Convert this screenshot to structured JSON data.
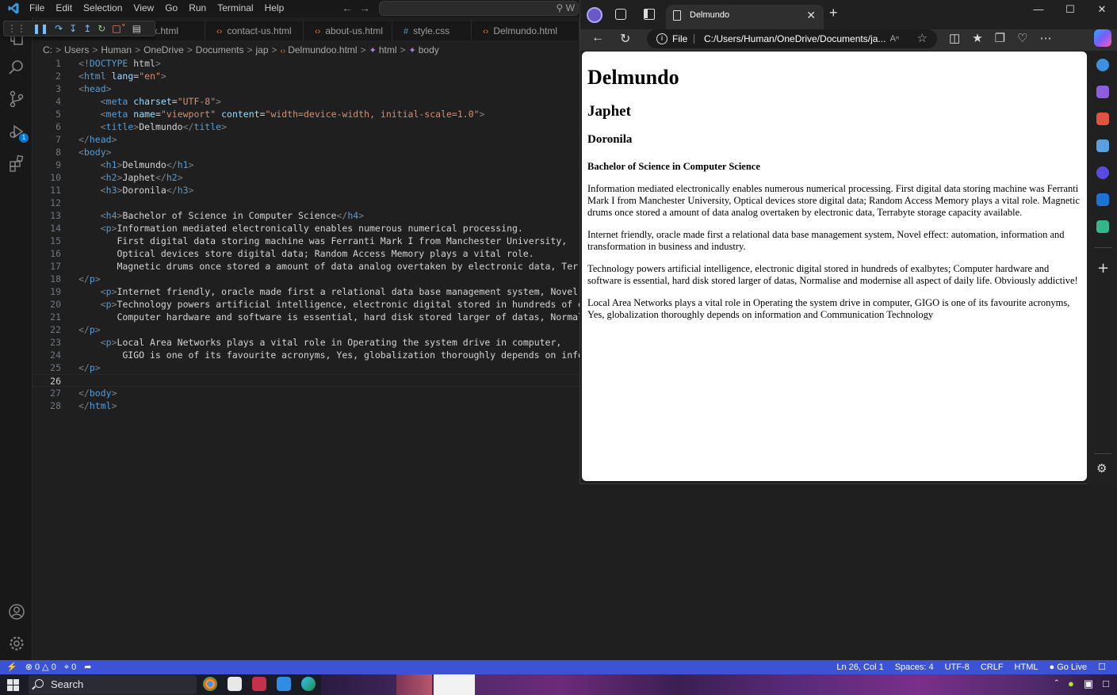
{
  "vscode": {
    "menu": [
      "File",
      "Edit",
      "Selection",
      "View",
      "Go",
      "Run",
      "Terminal",
      "Help"
    ],
    "command_center_text": "W",
    "tabs": [
      {
        "label": "x.html",
        "icon": "html-file-icon"
      },
      {
        "label": "contact-us.html",
        "icon": "html-file-icon"
      },
      {
        "label": "about-us.html",
        "icon": "html-file-icon"
      },
      {
        "label": "style.css",
        "icon": "css-file-icon"
      },
      {
        "label": "Delmundo.html",
        "icon": "html-file-icon"
      }
    ],
    "breadcrumb": [
      "C:",
      "Users",
      "Human",
      "OneDrive",
      "Documents",
      "jap",
      "Delmundoo.html",
      "html",
      "body"
    ],
    "code_lines": [
      "<!DOCTYPE html>",
      "<html lang=\"en\">",
      "<head>",
      "    <meta charset=\"UTF-8\">",
      "    <meta name=\"viewport\" content=\"width=device-width, initial-scale=1.0\">",
      "    <title>Delmundo</title>",
      "</head>",
      "<body>",
      "    <h1>Delmundo</h1>",
      "    <h2>Japhet</h2>",
      "    <h3>Doronila</h3>",
      "",
      "    <h4>Bachelor of Science in Computer Science</h4>",
      "    <p>Information mediated electronically enables numerous numerical processing.",
      "       First digital data storing machine was Ferranti Mark I from Manchester University,",
      "       Optical devices store digital data; Random Access Memory plays a vital role.",
      "       Magnetic drums once stored a amount of data analog overtaken by electronic data, Terrabyte",
      "</p>",
      "    <p>Internet friendly, oracle made first a relational data base management system, Novel effect",
      "    <p>Technology powers artificial intelligence, electronic digital stored in hundreds of exalbyt",
      "       Computer hardware and software is essential, hard disk stored larger of datas, Normalise ar",
      "</p>",
      "    <p>Local Area Networks plays a vital role in Operating the system drive in computer,",
      "        GIGO is one of its favourite acronyms, Yes, globalization thoroughly depends on informatic",
      "</p>",
      "",
      "</body>",
      "</html>"
    ],
    "current_line": 26,
    "status": {
      "errors": "0",
      "warnings": "0",
      "ports": "0",
      "position": "Ln 26, Col 1",
      "spaces": "Spaces: 4",
      "encoding": "UTF-8",
      "eol": "CRLF",
      "language": "HTML",
      "golive": "Go Live"
    }
  },
  "edge": {
    "tab_title": "Delmundo",
    "address_label": "File",
    "url": "C:/Users/Human/OneDrive/Documents/ja...",
    "page": {
      "h1": "Delmundo",
      "h2": "Japhet",
      "h3": "Doronila",
      "h4": "Bachelor of Science in Computer Science",
      "paragraphs": [
        "Information mediated electronically enables numerous numerical processing. First digital data storing machine was Ferranti Mark I from Manchester University, Optical devices store digital data; Random Access Memory plays a vital role. Magnetic drums once stored a amount of data analog overtaken by electronic data, Terrabyte storage capacity available.",
        "Internet friendly, oracle made first a relational data base management system, Novel effect: automation, information and transformation in business and industry.",
        "Technology powers artificial intelligence, electronic digital stored in hundreds of exalbytes; Computer hardware and software is essential, hard disk stored larger of datas, Normalise and modernise all aspect of daily life. Obviously addictive!",
        "Local Area Networks plays a vital role in Operating the system drive in computer, GIGO is one of its favourite acronyms, Yes, globalization thoroughly depends on information and Communication Technology"
      ]
    }
  },
  "taskbar": {
    "search_label": "Search"
  },
  "colors": {
    "statusbar": "#3c53d6",
    "editor_bg": "#1f1f1f",
    "tag": "#569cd6",
    "attr": "#9cdcfe",
    "string": "#ce9178"
  }
}
